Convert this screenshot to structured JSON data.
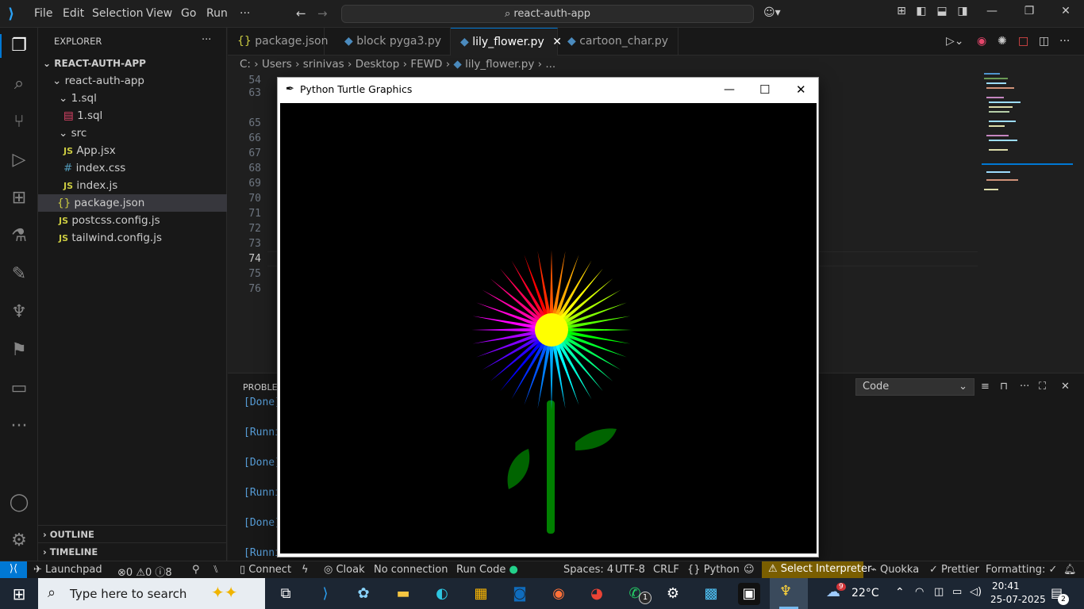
{
  "titlebar": {
    "menus": [
      "File",
      "Edit",
      "Selection",
      "View",
      "Go",
      "Run",
      "···"
    ],
    "command_center": "react-auth-app"
  },
  "explorer": {
    "title": "EXPLORER",
    "more": "···",
    "root": "REACT-AUTH-APP",
    "items": [
      {
        "label": "react-auth-app",
        "type": "folder"
      },
      {
        "label": "1.sql",
        "type": "folder"
      },
      {
        "label": "1.sql",
        "type": "sql"
      },
      {
        "label": "src",
        "type": "folder"
      },
      {
        "label": "App.jsx",
        "type": "js"
      },
      {
        "label": "index.css",
        "type": "css"
      },
      {
        "label": "index.js",
        "type": "js"
      },
      {
        "label": "package.json",
        "type": "json"
      },
      {
        "label": "postcss.config.js",
        "type": "js"
      },
      {
        "label": "tailwind.config.js",
        "type": "js"
      }
    ],
    "outline": "OUTLINE",
    "timeline": "TIMELINE"
  },
  "tabs": [
    {
      "label": "package.json",
      "icon": "{}"
    },
    {
      "label": "block pyga3.py",
      "icon": "python"
    },
    {
      "label": "lily_flower.py",
      "icon": "python",
      "active": true
    },
    {
      "label": "cartoon_char.py",
      "icon": "python"
    }
  ],
  "breadcrumb": [
    "C:",
    "Users",
    "srinivas",
    "Desktop",
    "FEWD",
    "lily_flower.py",
    "..."
  ],
  "line_numbers": [
    "54",
    "63",
    "65",
    "66",
    "67",
    "68",
    "69",
    "70",
    "71",
    "72",
    "73",
    "74",
    "75",
    "76"
  ],
  "active_line": "74",
  "panel": {
    "tab_label": "PROBLEM",
    "dropdown_value": "Code",
    "output_lines": [
      "[Done]",
      "[Runni",
      "[Done]",
      "[Runni",
      "[Done]",
      "[Runni"
    ]
  },
  "turtle_window": {
    "title": "Python Turtle Graphics",
    "colors": {
      "center": "#ffff00",
      "stem": "#008000",
      "leaf": "#006400",
      "background": "#000000"
    },
    "petal_count": 36
  },
  "statusbar": {
    "launchpad": "Launchpad",
    "errors": "0",
    "warnings": "0",
    "info": "0",
    "ports": "8",
    "connect": "Connect",
    "cloak": "Cloak",
    "no_connection": "No connection",
    "run_code": "Run Code",
    "spaces": "Spaces: 4",
    "encoding": "UTF-8",
    "eol": "CRLF",
    "language": "Python",
    "interpreter": "Select Interpreter",
    "quokka": "Quokka",
    "prettier": "Prettier",
    "formatting": "Formatting: ✓"
  },
  "taskbar": {
    "search_placeholder": "Type here to search",
    "weather": "22°C",
    "weather_badge": "9",
    "time": "20:41",
    "date": "25-07-2025",
    "notifications": "2",
    "whatsapp_badge": "1"
  }
}
